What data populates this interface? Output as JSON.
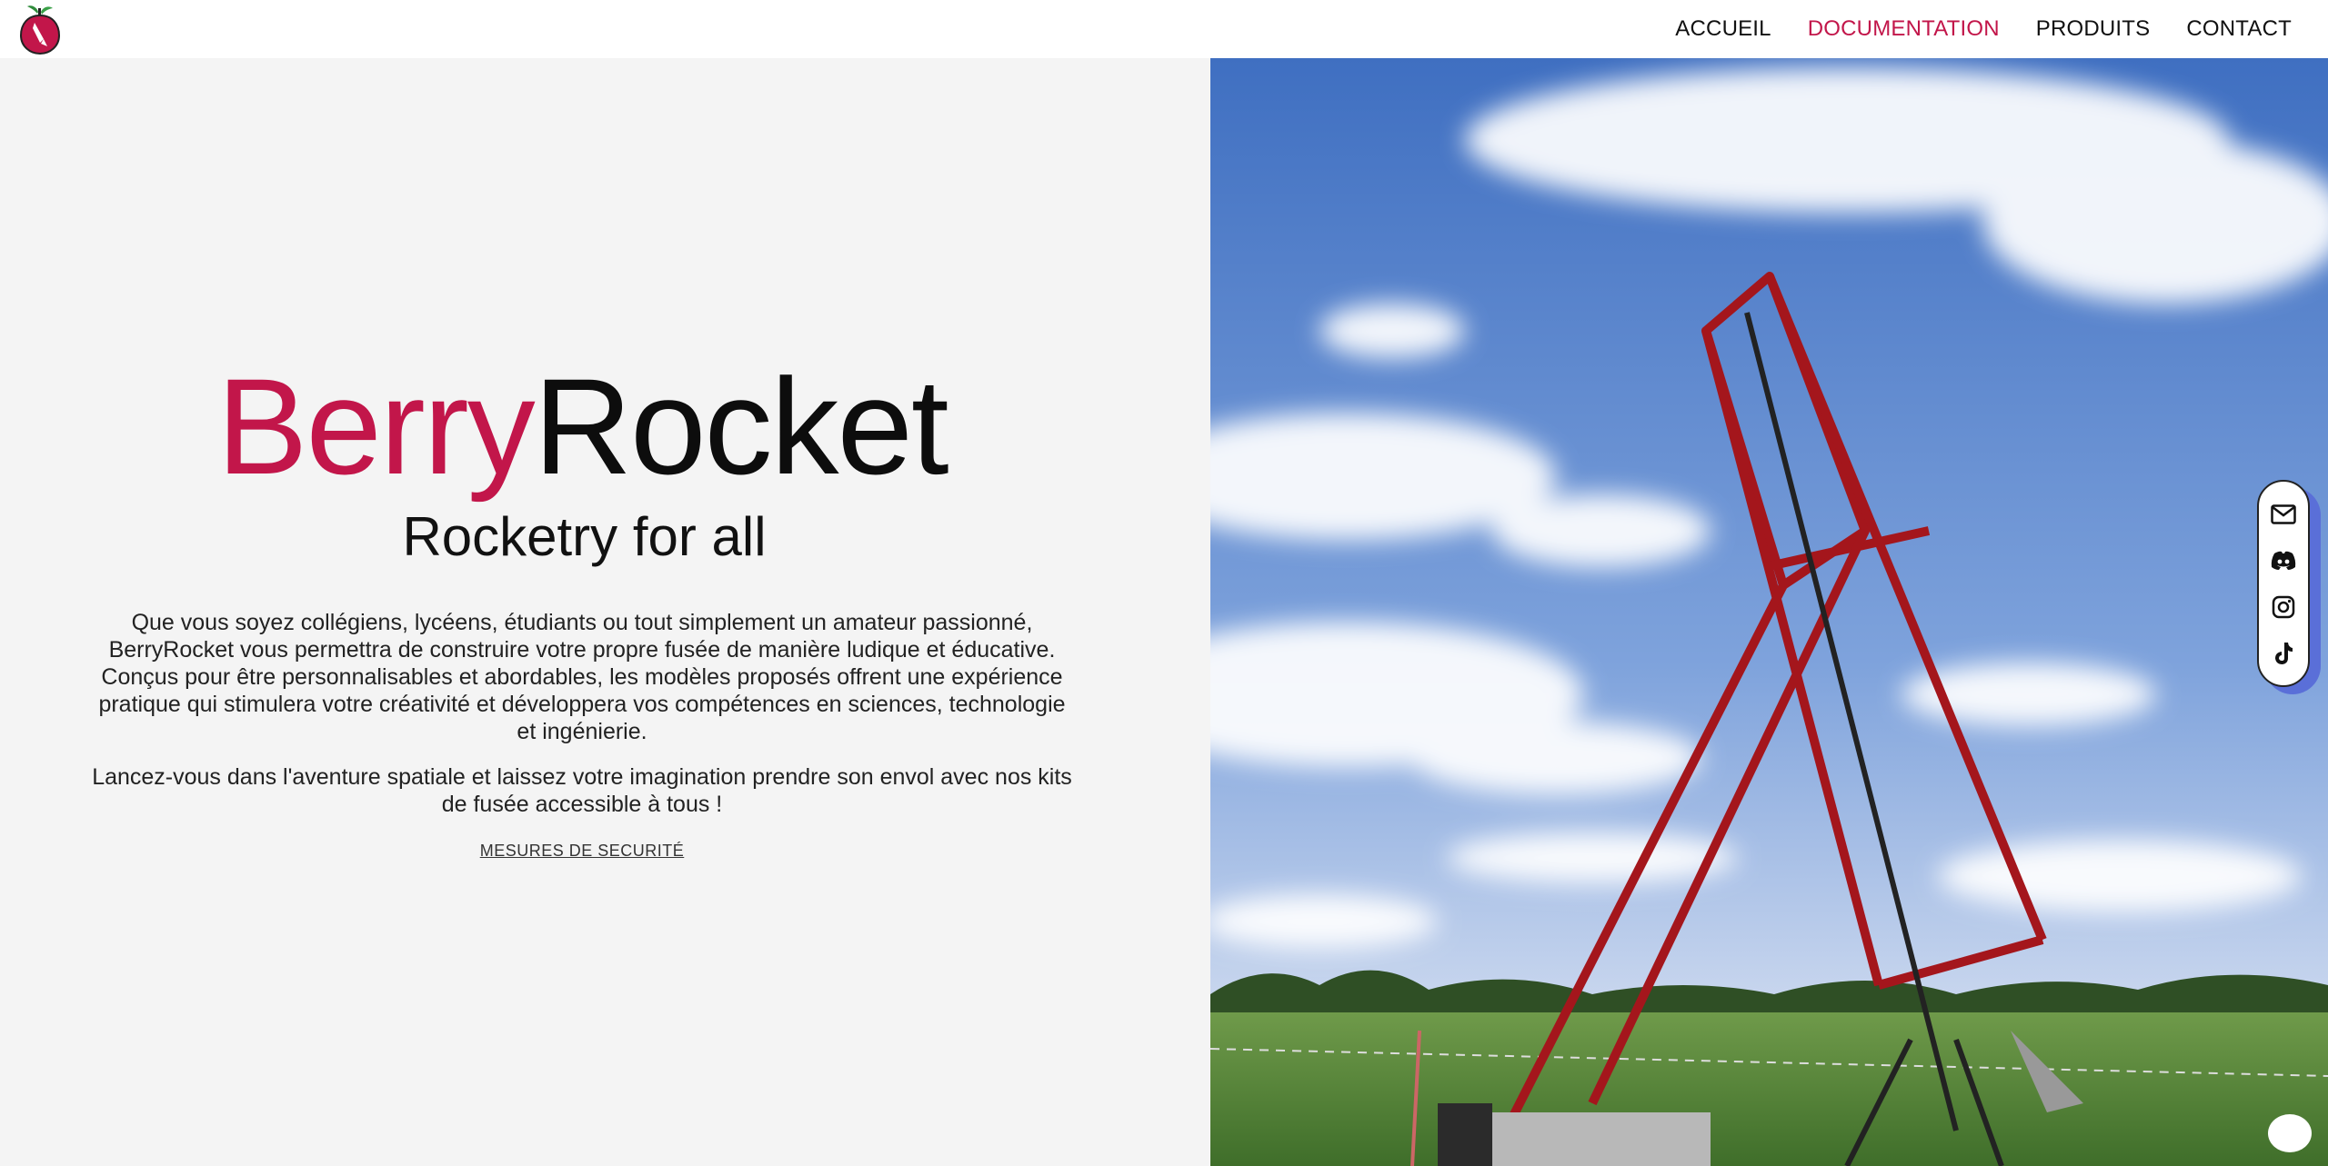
{
  "header": {
    "nav": [
      {
        "label": "ACCUEIL",
        "active": false
      },
      {
        "label": "DOCUMENTATION",
        "active": true
      },
      {
        "label": "PRODUITS",
        "active": false
      },
      {
        "label": "CONTACT",
        "active": false
      }
    ]
  },
  "hero": {
    "brand_part1": "Berry",
    "brand_part2": "Rocket",
    "tagline": "Rocketry for all",
    "paragraph1": "Que vous soyez collégiens, lycéens, étudiants ou tout simplement un amateur passionné, BerryRocket vous permettra de construire votre propre fusée de manière ludique et éducative. Conçus pour être personnalisables et abordables, les modèles proposés offrent une expérience pratique qui stimulera votre créativité et développera vos compétences en sciences, technologie et ingénierie.",
    "paragraph2": "Lancez-vous dans l'aventure spatiale et laissez votre imagination prendre son envol avec nos kits de fusée accessible à tous !",
    "safety_link": "MESURES DE SECURITÉ"
  },
  "social": [
    "mail-icon",
    "discord-icon",
    "instagram-icon",
    "tiktok-icon"
  ],
  "colors": {
    "accent": "#c2164a",
    "text": "#111111",
    "panel": "#f4f4f4"
  }
}
